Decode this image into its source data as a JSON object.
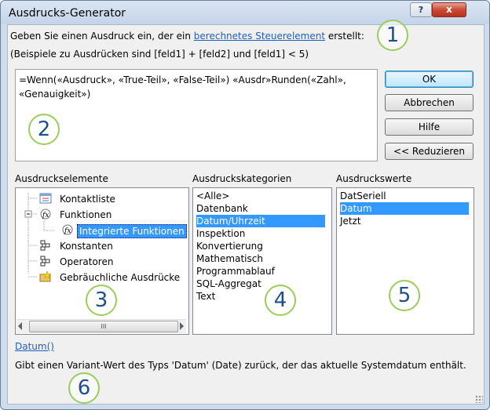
{
  "window": {
    "title": "Ausdrucks-Generator",
    "help_glyph": "?",
    "close_glyph": "x"
  },
  "intro": {
    "line1_pre": "Geben Sie einen Ausdruck ein, der ein ",
    "line1_link": "berechnetes Steuerelement",
    "line1_post": " erstellt:",
    "line2": "(Beispiele zu Ausdrücken sind [feld1] + [feld2] und [feld1] < 5)"
  },
  "expression": {
    "text": "=Wenn(«Ausdruck», «True-Teil», «False-Teil») «Ausdr»Runden(«Zahl», «Genauigkeit»)"
  },
  "buttons": {
    "ok": "OK",
    "cancel": "Abbrechen",
    "help": "Hilfe",
    "reduce": "<< Reduzieren"
  },
  "elements": {
    "label": "Ausdruckselemente",
    "items": [
      {
        "label": "Kontaktliste",
        "icon": "form-icon"
      },
      {
        "label": "Funktionen",
        "icon": "function-icon"
      },
      {
        "label": "Integrierte Funktionen",
        "icon": "function-icon"
      },
      {
        "label": "Konstanten",
        "icon": "folder-tree-icon"
      },
      {
        "label": "Operatoren",
        "icon": "folder-tree-icon"
      },
      {
        "label": "Gebräuchliche Ausdrücke",
        "icon": "star-folder-icon"
      }
    ],
    "selected": "Integrierte Funktionen",
    "scroll_grip": "III"
  },
  "categories": {
    "label": "Ausdruckskategorien",
    "items": [
      "<Alle>",
      "Datenbank",
      "Datum/Uhrzeit",
      "Inspektion",
      "Konvertierung",
      "Mathematisch",
      "Programmablauf",
      "SQL-Aggregat",
      "Text"
    ],
    "selected": "Datum/Uhrzeit"
  },
  "values": {
    "label": "Ausdruckswerte",
    "items": [
      "DatSeriell",
      "Datum",
      "Jetzt"
    ],
    "selected": "Datum"
  },
  "description": {
    "link": "Datum()",
    "text": "Gibt einen Variant-Wert des Typs 'Datum' (Date) zurück, der das aktuelle Systemdatum enthält."
  },
  "callouts": [
    "1",
    "2",
    "3",
    "4",
    "5",
    "6"
  ],
  "colors": {
    "selection": "#3399ff",
    "link": "#1f5fbf",
    "callout_border": "#9acd5c",
    "callout_text": "#1e4f8a"
  }
}
